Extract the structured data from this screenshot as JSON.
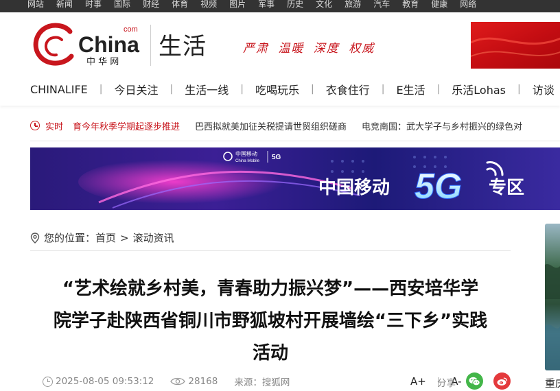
{
  "topbar": {
    "links": [
      "网站",
      "新闻",
      "时事",
      "国际",
      "财经",
      "体育",
      "视频",
      "图片",
      "军事",
      "历史",
      "文化",
      "旅游",
      "汽车",
      "教育",
      "健康",
      "网络"
    ]
  },
  "header": {
    "logo_brand": "China",
    "logo_com": "com",
    "logo_cn": "中 华 网",
    "channel_title": "生活",
    "slogan": "严肃 温暖 深度 权威"
  },
  "nav": {
    "items": [
      "CHINALIFE",
      "今日关注",
      "生活一线",
      "吃喝玩乐",
      "衣食住行",
      "E生活",
      "乐活Lohas",
      "访谈"
    ],
    "separator": "|"
  },
  "ticker": {
    "label": "实时",
    "items": [
      "育今年秋季学期起逐步推进",
      "巴西拟就美加征关税提请世贸组织磋商",
      "电竞南国：武大学子与乡村振兴的绿色对"
    ]
  },
  "ad_banner": {
    "brand_cn": "中国移动",
    "brand_en": "China Mobile",
    "tag": "5G",
    "headline_pre": "中国移动",
    "headline_5g": "5G",
    "headline_post": "专区"
  },
  "breadcrumb": {
    "prefix": "您的位置：",
    "home": "首页",
    "separator": ">",
    "current": "滚动资讯"
  },
  "article": {
    "title_lines": [
      "“艺术绘就乡村美，青春助力振兴梦”——西安培华学",
      "院学子赴陕西省铜川市野狐坡村开展墙绘“三下乡”实践",
      "活动"
    ],
    "datetime": "2025-08-05 09:53:12",
    "views": "28168",
    "source_label": "来源：",
    "source": "搜狐网",
    "font_larger": "A+",
    "font_smaller": "A-",
    "share_label": "分享"
  },
  "sidebar": {
    "caption": "重庆"
  },
  "colors": {
    "brand_red": "#c8161d",
    "topbar_bg": "#333333",
    "wechat_green": "#43b649",
    "weibo_red": "#e4393c"
  }
}
